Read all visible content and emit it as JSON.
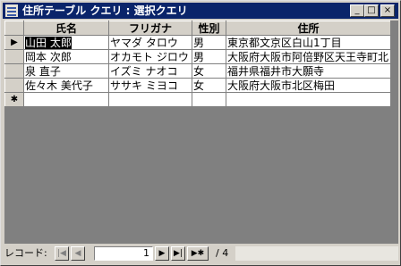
{
  "window": {
    "title": "住所テーブル クエリ : 選択クエリ"
  },
  "title_buttons": {
    "minimize": "_",
    "maximize": "□",
    "close": "×"
  },
  "columns": [
    "氏名",
    "フリガナ",
    "性別",
    "住所"
  ],
  "rows": [
    [
      "山田 太郎",
      "ヤマダ タロウ",
      "男",
      "東京都文京区白山1丁目"
    ],
    [
      "岡本 次郎",
      "オカモト ジロウ",
      "男",
      "大阪府大阪市阿倍野区天王寺町北"
    ],
    [
      "泉 直子",
      "イズミ ナオコ",
      "女",
      "福井県福井市大願寺"
    ],
    [
      "佐々木 美代子",
      "ササキ ミヨコ",
      "女",
      "大阪府大阪市北区梅田"
    ]
  ],
  "current_row_marker": "▶",
  "new_row_marker": "✱",
  "navigation": {
    "label": "レコード:",
    "current": "1",
    "total": "/ 4",
    "first_icon": "first-record-icon",
    "prev_icon": "prev-record-icon",
    "next_icon": "next-record-icon",
    "last_icon": "last-record-icon",
    "new_icon": "new-record-icon"
  }
}
